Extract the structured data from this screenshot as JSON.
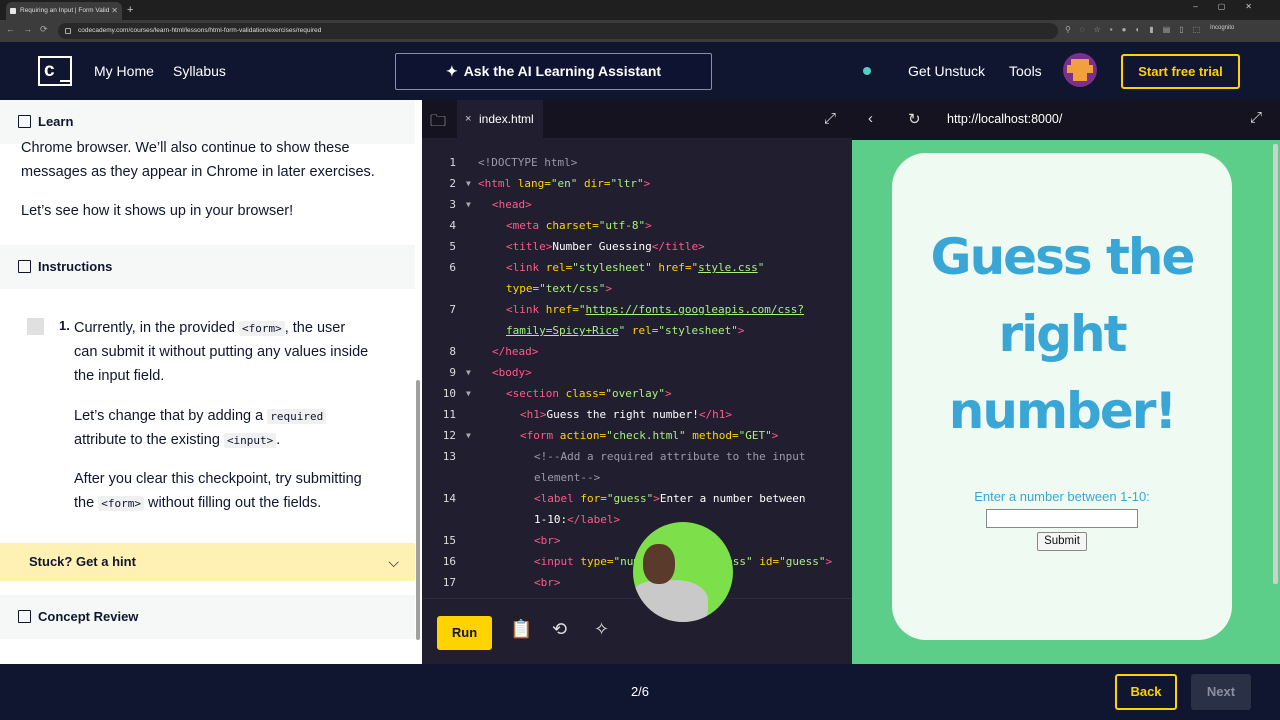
{
  "browser": {
    "tab_title": "Requiring an Input | Form Valid",
    "url": "codecademy.com/courses/learn-html/lessons/html-form-validation/exercises/required",
    "incognito": "Incognito"
  },
  "header": {
    "logo": "c",
    "nav": [
      "My Home",
      "Syllabus"
    ],
    "ai_button": "Ask the AI Learning Assistant",
    "get_unstuck": "Get Unstuck",
    "tools": "Tools",
    "start_trial": "Start free trial"
  },
  "learn": {
    "heading": "Learn",
    "p1_line1": "Chrome browser. We’ll also continue to show these",
    "p1_line2": "messages as they appear in Chrome in later exercises.",
    "p2": "Let’s see how it shows up in your browser!"
  },
  "instructions": {
    "heading": "Instructions",
    "number": "1.",
    "l1a": "Currently, in the provided",
    "code_form": "<form>",
    "l1b": ", the user",
    "l2": "can submit it without putting any values inside",
    "l3": "the input field.",
    "l4a": "Let’s change that by adding a",
    "code_required": "required",
    "l5a": "attribute to the existing",
    "code_input": "<input>",
    "l5b": ".",
    "l6": "After you clear this checkpoint, try submitting",
    "l7a": "the",
    "code_form2": "<form>",
    "l7b": "without filling out the fields."
  },
  "hint": {
    "label": "Stuck? Get a hint"
  },
  "concept": {
    "heading": "Concept Review"
  },
  "editor": {
    "file_tab": "index.html",
    "run": "Run",
    "line_numbers": [
      "1",
      "2",
      "3",
      "4",
      "5",
      "6",
      "",
      "7",
      "",
      "8",
      "9",
      "10",
      "11",
      "12",
      "13",
      "",
      "14",
      "",
      "15",
      "16",
      "17"
    ]
  },
  "preview": {
    "url": "http://localhost:8000/",
    "title_l1": "Guess the",
    "title_l2": "right",
    "title_l3": "number!",
    "label": "Enter a number between 1-10:",
    "submit": "Submit"
  },
  "footer": {
    "progress": "2/6",
    "back": "Back",
    "next": "Next"
  }
}
